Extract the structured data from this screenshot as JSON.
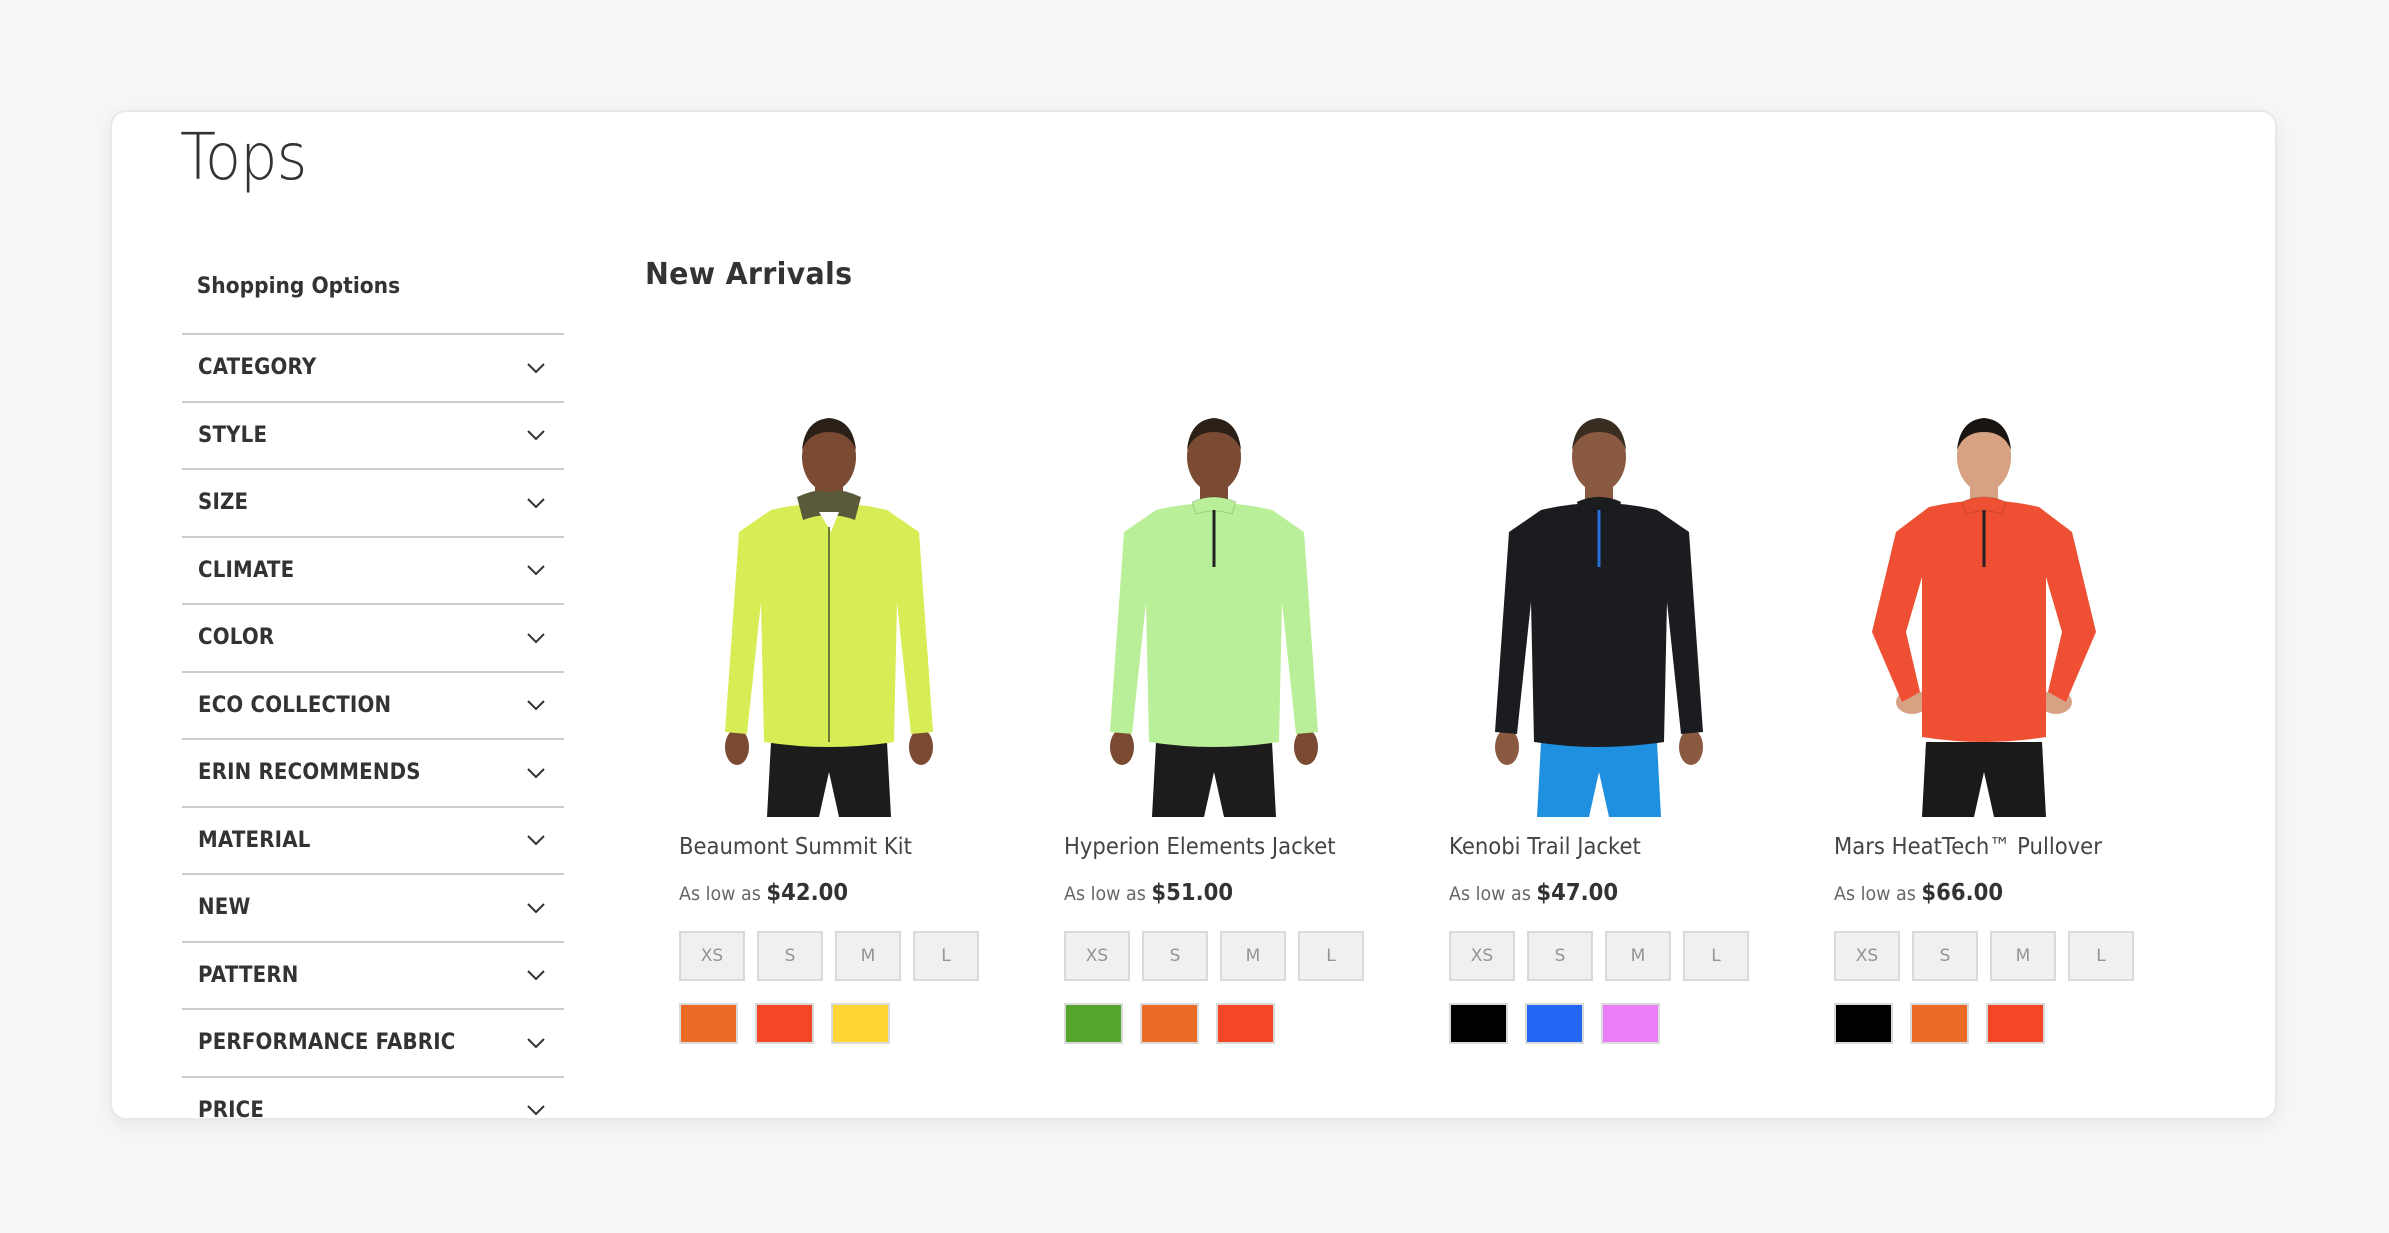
{
  "page": {
    "title": "Tops"
  },
  "sidebar": {
    "heading": "Shopping Options",
    "filters": [
      {
        "label": "CATEGORY",
        "icon": "chevron-down-icon"
      },
      {
        "label": "STYLE",
        "icon": "chevron-down-icon"
      },
      {
        "label": "SIZE",
        "icon": "chevron-down-icon"
      },
      {
        "label": "CLIMATE",
        "icon": "chevron-down-icon"
      },
      {
        "label": "COLOR",
        "icon": "chevron-down-icon"
      },
      {
        "label": "ECO COLLECTION",
        "icon": "chevron-down-icon"
      },
      {
        "label": "ERIN RECOMMENDS",
        "icon": "chevron-down-icon"
      },
      {
        "label": "MATERIAL",
        "icon": "chevron-down-icon"
      },
      {
        "label": "NEW",
        "icon": "chevron-down-icon"
      },
      {
        "label": "PATTERN",
        "icon": "chevron-down-icon"
      },
      {
        "label": "PERFORMANCE FABRIC",
        "icon": "chevron-down-icon"
      },
      {
        "label": "PRICE",
        "icon": "chevron-down-icon"
      }
    ]
  },
  "main": {
    "section_title": "New Arrivals",
    "products": [
      {
        "name": "Beaumont Summit Kit",
        "price_label": "As low as",
        "price": "$42.00",
        "image": {
          "garment_color": "#d8ec55",
          "garment_style": "hooded-jacket",
          "pants_color": "#1c1c1c",
          "skin": "#7a4a33",
          "hair": "#2a2018"
        },
        "sizes": [
          "XS",
          "S",
          "M",
          "L"
        ],
        "colors": [
          "#eb6a25",
          "#f44726",
          "#fed535"
        ]
      },
      {
        "name": "Hyperion Elements Jacket",
        "price_label": "As low as",
        "price": "$51.00",
        "image": {
          "garment_color": "#b9ef98",
          "garment_style": "half-zip",
          "pants_color": "#1c1c1c",
          "skin": "#7a4a33",
          "hair": "#2a2018"
        },
        "sizes": [
          "XS",
          "S",
          "M",
          "L"
        ],
        "colors": [
          "#53a62b",
          "#eb6a25",
          "#f44726"
        ]
      },
      {
        "name": "Kenobi Trail Jacket",
        "price_label": "As low as",
        "price": "$47.00",
        "image": {
          "garment_color": "#1b1c20",
          "garment_style": "half-zip-blue",
          "pants_color": "#1f8fe0",
          "skin": "#8a5a40",
          "hair": "#3a2e22"
        },
        "sizes": [
          "XS",
          "S",
          "M",
          "L"
        ],
        "colors": [
          "#000000",
          "#2367f5",
          "#ea7ef6"
        ]
      },
      {
        "name": "Mars HeatTech™ Pullover",
        "price_label": "As low as",
        "price": "$66.00",
        "image": {
          "garment_color": "#ef4f33",
          "garment_style": "half-zip-hands-hips",
          "pants_color": "#1a1a1a",
          "skin": "#d6a282",
          "hair": "#1b1512"
        },
        "sizes": [
          "XS",
          "S",
          "M",
          "L"
        ],
        "colors": [
          "#000000",
          "#eb6a25",
          "#f44726"
        ]
      }
    ]
  }
}
